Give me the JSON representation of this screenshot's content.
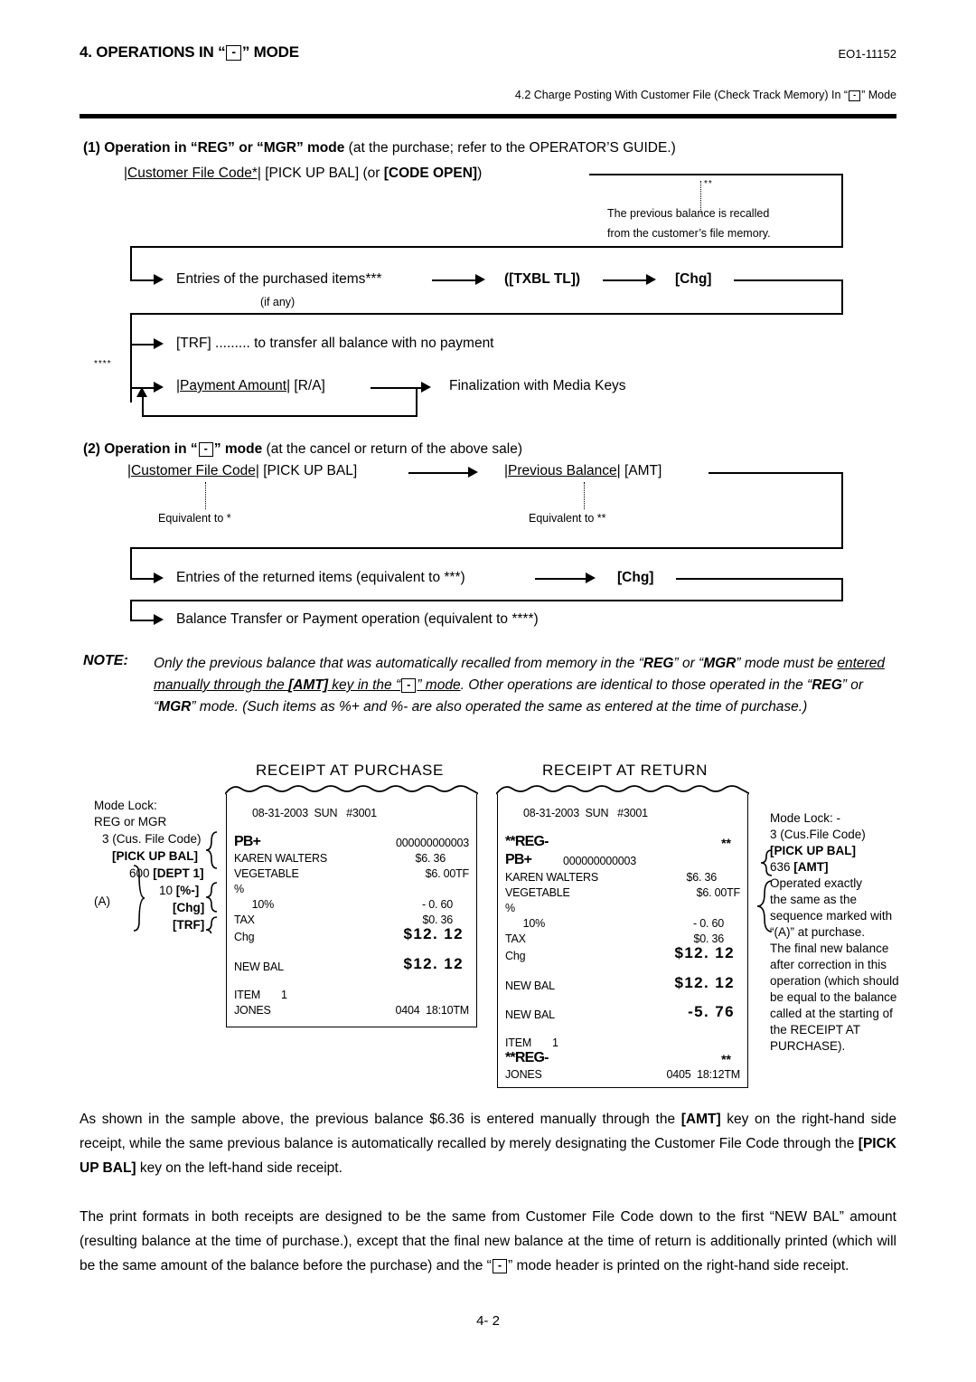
{
  "header": {
    "title_prefix": "4. OPERATIONS IN “",
    "title_key": "-",
    "title_suffix": "” MODE",
    "doc_number": "EO1-11152",
    "subheader_prefix": "4.2 Charge Posting With Customer File (Check Track Memory) In “",
    "subheader_key": "-",
    "subheader_suffix": "” Mode"
  },
  "section1": {
    "heading_bold": "(1) Operation in “REG” or “MGR” mode",
    "heading_rest": " (at the purchase; refer to the OPERATOR’S GUIDE.)",
    "step1_code": "|Customer File Code*|",
    "step1_keys": " [PICK UP BAL]",
    "step1_or_open": " (or ",
    "step1_or_key": "[CODE OPEN]",
    "step1_or_close": ")",
    "callout_marker": "**",
    "callout_line1": "The previous balance is recalled",
    "callout_line2": "from the customer’s file memory.",
    "step2_text": "Entries of the purchased items***",
    "step2_note": "(if any)",
    "step2_txbl": "([TXBL TL])",
    "step2_chg": "[Chg]",
    "marker4": "****",
    "step3_key": "[TRF]",
    "step3_text": " ......... to transfer all balance with no payment",
    "step4_amount": "|Payment Amount|",
    "step4_key": " [R/A]",
    "step4_text": "Finalization with Media Keys"
  },
  "section2": {
    "heading_bold_a": "(2) Operation in “",
    "heading_key": "-",
    "heading_bold_b": "” mode",
    "heading_rest": " (at the cancel or return of the above sale)",
    "step1_code": "|Customer File Code|",
    "step1_key": " [PICK UP BAL]",
    "step1_equiv": "Equivalent to *",
    "step2_code": "|Previous Balance|",
    "step2_key": " [AMT]",
    "step2_equiv": "Equivalent to **",
    "step3_text": "Entries of the returned items (equivalent to ***)",
    "step3_chg": "[Chg]",
    "step4_text": "Balance Transfer or Payment operation (equivalent to ****)"
  },
  "note": {
    "label": "NOTE:",
    "part1": "Only the previous balance that was automatically recalled from memory in the “",
    "reg": "REG",
    "or1": "” or “",
    "mgr": "MGR",
    "part2": "” mode must be ",
    "underline_a": "entered manually through the ",
    "amt": "[AMT]",
    "underline_b": " key in the “",
    "key": "-",
    "underline_c": "” mode",
    "part3": ".  Other operations are identical to those operated in the “",
    "reg2": "REG",
    "or2": "” or “",
    "mgr2": "MGR",
    "part4": "” mode. (Such items as %+ and %- are also operated the same as entered at the time of purchase.)"
  },
  "receipt_purchase": {
    "title": "RECEIPT AT PURCHASE",
    "mode_lock_line1": "Mode Lock:",
    "mode_lock_line2": "REG or MGR",
    "annotations": [
      "3 (Cus. File Code)",
      "[PICK UP BAL]",
      "600 [DEPT 1]",
      "10 [%-]",
      "[Chg]",
      "[TRF]",
      "(A)"
    ],
    "lines": [
      {
        "left": "08-31-2003  SUN   #3001",
        "right": "",
        "style": "date"
      },
      {
        "left": "PB+",
        "right": "000000000003",
        "style": "bold-left"
      },
      {
        "left": "KAREN WALTERS",
        "right": "$6. 36",
        "style": "normal"
      },
      {
        "left": "VEGETABLE",
        "right": "$6. 00TF",
        "style": "normal"
      },
      {
        "left": "%",
        "right": "",
        "style": "normal"
      },
      {
        "left": "      10%",
        "right": "- 0. 60",
        "style": "normal"
      },
      {
        "left": "TAX",
        "right": "$0. 36",
        "style": "normal"
      },
      {
        "left": "Chg",
        "right": "$12. 12",
        "style": "big-right"
      },
      {
        "left": "NEW BAL",
        "right": "$12. 12",
        "style": "big-right"
      },
      {
        "left": "ITEM       1",
        "right": "",
        "style": "normal"
      },
      {
        "left": "JONES",
        "right": "0404  18:10TM",
        "style": "normal"
      }
    ]
  },
  "receipt_return": {
    "title": "RECEIPT AT RETURN",
    "lines": [
      {
        "left": "08-31-2003  SUN   #3001",
        "right": "",
        "style": "date"
      },
      {
        "left": "**REG-",
        "right": "**",
        "style": "reg-header"
      },
      {
        "left": "PB+",
        "right": "000000000003",
        "style": "pb-line"
      },
      {
        "left": "KAREN WALTERS",
        "right": "$6. 36",
        "style": "normal"
      },
      {
        "left": "VEGETABLE",
        "right": "$6. 00TF",
        "style": "normal"
      },
      {
        "left": "%",
        "right": "",
        "style": "normal"
      },
      {
        "left": "      10%",
        "right": "- 0. 60",
        "style": "normal"
      },
      {
        "left": "TAX",
        "right": "$0. 36",
        "style": "normal"
      },
      {
        "left": "Chg",
        "right": "$12. 12",
        "style": "big-right"
      },
      {
        "left": "NEW BAL",
        "right": "$12. 12",
        "style": "big-right"
      },
      {
        "left": "NEW BAL",
        "right": "-5. 76",
        "style": "big-right"
      },
      {
        "left": "ITEM       1",
        "right": "",
        "style": "normal"
      },
      {
        "left": "**REG-",
        "right": "**",
        "style": "reg-header"
      },
      {
        "left": "JONES",
        "right": "0405  18:12TM",
        "style": "normal"
      }
    ],
    "annotation_lines": [
      "Mode Lock: -",
      "3 (Cus.File Code)",
      "[PICK UP BAL]",
      "636 [AMT]",
      "Operated exactly",
      "the same as the",
      "sequence marked with",
      "“(A)” at purchase.",
      "The final new balance",
      "after correction in this",
      "operation (which should",
      "be equal to the balance",
      "called at the starting of",
      "the  RECEIPT AT",
      "PURCHASE)."
    ]
  },
  "paragraphs": {
    "p1_a": "As shown in the sample above, the previous balance $6.36 is entered manually through the ",
    "p1_amt": "[AMT]",
    "p1_b": " key on the right-hand side receipt, while the same previous balance is automatically recalled by merely designating the Customer File Code through the ",
    "p1_pickup": "[PICK UP BAL]",
    "p1_c": " key on the left-hand side receipt.",
    "p2_a": "The print formats in both receipts are designed to be the same from Customer File Code down to the first “NEW BAL” amount (resulting balance at the time of purchase.), except that the final new balance at the time of return is additionally printed (which will be the same amount of the balance before the purchase) and the “",
    "p2_key": "-",
    "p2_b": "” mode header is printed on the right-hand side receipt."
  },
  "footer": {
    "page_number": "4- 2"
  }
}
